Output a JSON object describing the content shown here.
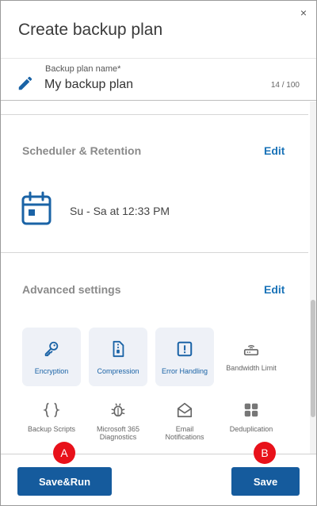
{
  "dialog": {
    "title": "Create backup plan",
    "close_glyph": "×"
  },
  "plan_name": {
    "label": "Backup plan name*",
    "value": "My backup plan",
    "counter": "14 / 100",
    "icon": "pencil-icon"
  },
  "scheduler": {
    "title": "Scheduler & Retention",
    "edit_label": "Edit",
    "schedule_text": "Su - Sa at 12:33 PM",
    "icon": "calendar-icon"
  },
  "advanced": {
    "title": "Advanced settings",
    "edit_label": "Edit",
    "tiles": [
      {
        "label": "Encryption",
        "icon": "key-icon",
        "enabled": true
      },
      {
        "label": "Compression",
        "icon": "archive-file-icon",
        "enabled": true
      },
      {
        "label": "Error Handling",
        "icon": "exclamation-icon",
        "enabled": true
      },
      {
        "label": "Bandwidth Limit",
        "icon": "router-icon",
        "enabled": false
      },
      {
        "label": "Backup Scripts",
        "icon": "curly-braces-icon",
        "enabled": false
      },
      {
        "label": "Microsoft 365 Diagnostics",
        "icon": "bug-icon",
        "enabled": false
      },
      {
        "label": "Email Notifications",
        "icon": "envelope-icon",
        "enabled": false
      },
      {
        "label": "Deduplication",
        "icon": "grid-blocks-icon",
        "enabled": false
      }
    ]
  },
  "footer": {
    "save_run_label": "Save&Run",
    "save_label": "Save"
  },
  "markers": {
    "a": "A",
    "b": "B"
  },
  "colors": {
    "accent": "#155b9d",
    "link": "#1a73b8",
    "tile_bg": "#eef1f7",
    "marker": "#e8111a"
  }
}
